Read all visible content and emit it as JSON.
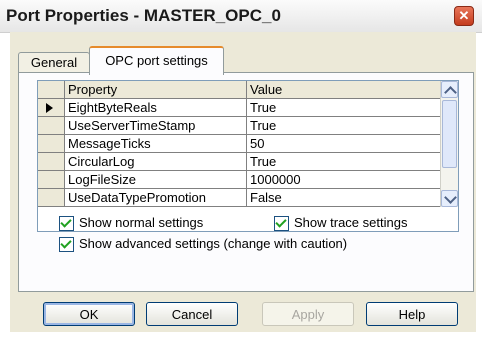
{
  "window": {
    "title": "Port Properties - MASTER_OPC_0",
    "close_symbol": "✕"
  },
  "tabs": [
    {
      "label": "General",
      "active": false
    },
    {
      "label": "OPC port settings",
      "active": true
    }
  ],
  "grid": {
    "headers": {
      "property": "Property",
      "value": "Value"
    },
    "rows": [
      {
        "property": "EightByteReals",
        "value": "True",
        "current": true
      },
      {
        "property": "UseServerTimeStamp",
        "value": "True"
      },
      {
        "property": "MessageTicks",
        "value": "50"
      },
      {
        "property": "CircularLog",
        "value": "True"
      },
      {
        "property": "LogFileSize",
        "value": "1000000"
      },
      {
        "property": "UseDataTypePromotion",
        "value": "False"
      }
    ]
  },
  "options": {
    "show_normal": {
      "label": "Show normal settings",
      "checked": true
    },
    "show_trace": {
      "label": "Show trace settings",
      "checked": true
    },
    "show_advanced": {
      "label": "Show advanced settings (change with caution)",
      "checked": true
    }
  },
  "buttons": {
    "ok": "OK",
    "cancel": "Cancel",
    "apply": "Apply",
    "help": "Help"
  },
  "colors": {
    "active_tab_accent": "#e68b2c",
    "checkmark": "#21a121",
    "button_border": "#003c74"
  }
}
